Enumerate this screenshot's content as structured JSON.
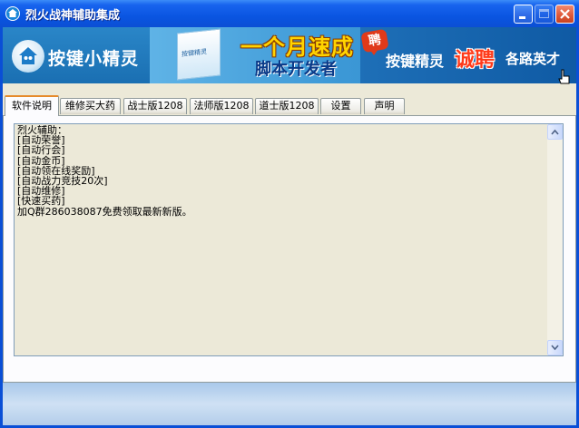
{
  "window": {
    "title": "烈火战神辅助集成"
  },
  "banner": {
    "logo_text": "按键小精灵",
    "ad_headline": "一个月速成",
    "ad_subline": "脚本开发者",
    "ad_box_label": "按键精灵",
    "ad_pin": "聘",
    "ad_brand": "按键精灵",
    "ad_recruit": "诚聘",
    "ad_talent": "各路英才"
  },
  "tabs": [
    {
      "label": "软件说明",
      "active": true
    },
    {
      "label": "维修买大药",
      "active": false
    },
    {
      "label": "战士版1208",
      "active": false
    },
    {
      "label": "法师版1208",
      "active": false
    },
    {
      "label": "道士版1208",
      "active": false
    },
    {
      "label": "设置",
      "active": false
    },
    {
      "label": "声明",
      "active": false
    }
  ],
  "description": {
    "lines": [
      "烈火辅助：",
      "[自动荣誉]",
      "[自动行会]",
      "[自动金币]",
      "[自动领在线奖励]",
      "[自动战力竞技20次]",
      "[自动维修]",
      "[快速买药]",
      "加Q群286038087免费领取最新新版。"
    ]
  },
  "colors": {
    "titlebar": "#0a55e2",
    "face": "#ece9d8",
    "active_tab_accent": "#e68b2c",
    "ad_highlight": "#ffd400"
  }
}
